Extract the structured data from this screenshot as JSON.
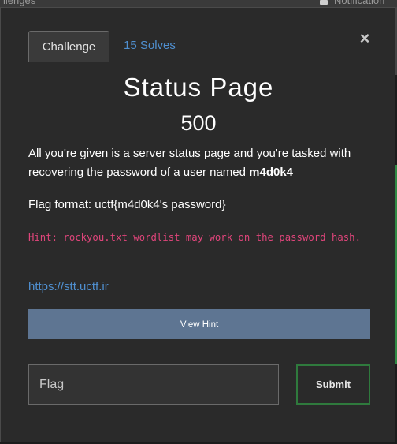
{
  "background": {
    "left_text": "llenges",
    "right_text": "Notification"
  },
  "modal": {
    "tabs": {
      "active": "Challenge",
      "solves": "15 Solves"
    },
    "close_glyph": "×",
    "title": "Status Page",
    "points": "500",
    "description": {
      "text": "All you're given is a server status page and you're tasked with recovering the password of a user named ",
      "bold": "m4d0k4"
    },
    "flag_format": "Flag format: uctf{m4d0k4's password}",
    "hint_text": "Hint: rockyou.txt wordlist may work on the password hash.",
    "link": "https://stt.uctf.ir",
    "view_hint_label": "View Hint",
    "flag_input": {
      "placeholder": "Flag",
      "value": ""
    },
    "submit_label": "Submit"
  },
  "colors": {
    "modal_bg": "#2a2a2a",
    "link": "#4f8fd0",
    "hint": "#e0457b",
    "view_hint_button": "#5e7592",
    "submit_border": "#2f7a3d"
  }
}
